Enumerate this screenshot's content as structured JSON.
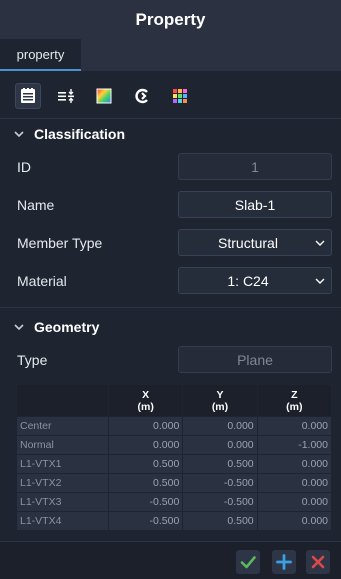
{
  "window": {
    "title": "Property"
  },
  "tabs": [
    {
      "label": "property",
      "active": true
    }
  ],
  "toolbar": {
    "icons": [
      "list-form-icon",
      "align-icon",
      "color-gradient-icon",
      "refresh-icon",
      "color-grid-icon"
    ],
    "active_index": 0
  },
  "classification": {
    "title": "Classification",
    "fields": {
      "id": {
        "label": "ID",
        "value": "1"
      },
      "name": {
        "label": "Name",
        "value": "Slab-1"
      },
      "member_type": {
        "label": "Member Type",
        "value": "Structural"
      },
      "material": {
        "label": "Material",
        "value": "1: C24"
      }
    }
  },
  "geometry": {
    "title": "Geometry",
    "type": {
      "label": "Type",
      "value": "Plane"
    },
    "table": {
      "columns": [
        {
          "name": "X",
          "unit": "(m)"
        },
        {
          "name": "Y",
          "unit": "(m)"
        },
        {
          "name": "Z",
          "unit": "(m)"
        }
      ],
      "rows": [
        {
          "label": "Center",
          "x": "0.000",
          "y": "0.000",
          "z": "0.000"
        },
        {
          "label": "Normal",
          "x": "0.000",
          "y": "0.000",
          "z": "-1.000"
        },
        {
          "label": "L1-VTX1",
          "x": "0.500",
          "y": "0.500",
          "z": "0.000"
        },
        {
          "label": "L1-VTX2",
          "x": "0.500",
          "y": "-0.500",
          "z": "0.000"
        },
        {
          "label": "L1-VTX3",
          "x": "-0.500",
          "y": "-0.500",
          "z": "0.000"
        },
        {
          "label": "L1-VTX4",
          "x": "-0.500",
          "y": "0.500",
          "z": "0.000"
        }
      ]
    }
  },
  "footer": {
    "buttons": [
      "confirm-icon",
      "add-icon",
      "delete-icon"
    ]
  },
  "colors": {
    "accent": "#4a90d9",
    "confirm": "#5cb85c",
    "add": "#3ba0e0",
    "delete": "#e04848"
  }
}
